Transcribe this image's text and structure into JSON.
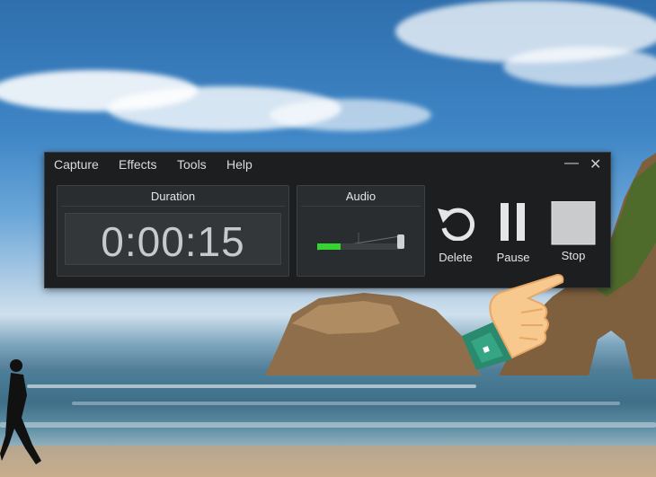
{
  "menu": {
    "capture": "Capture",
    "effects": "Effects",
    "tools": "Tools",
    "help": "Help"
  },
  "window_controls": {
    "minimize": "—",
    "close": "✕"
  },
  "duration_panel": {
    "title": "Duration",
    "time": "0:00:15"
  },
  "audio_panel": {
    "title": "Audio",
    "level": 0.28
  },
  "controls": {
    "delete": "Delete",
    "pause": "Pause",
    "stop": "Stop"
  },
  "colors": {
    "window_bg": "#1c1e20",
    "panel_bg": "#2a2d30",
    "audio_level": "#36d42f",
    "stop_button": "#c9cbcd"
  }
}
